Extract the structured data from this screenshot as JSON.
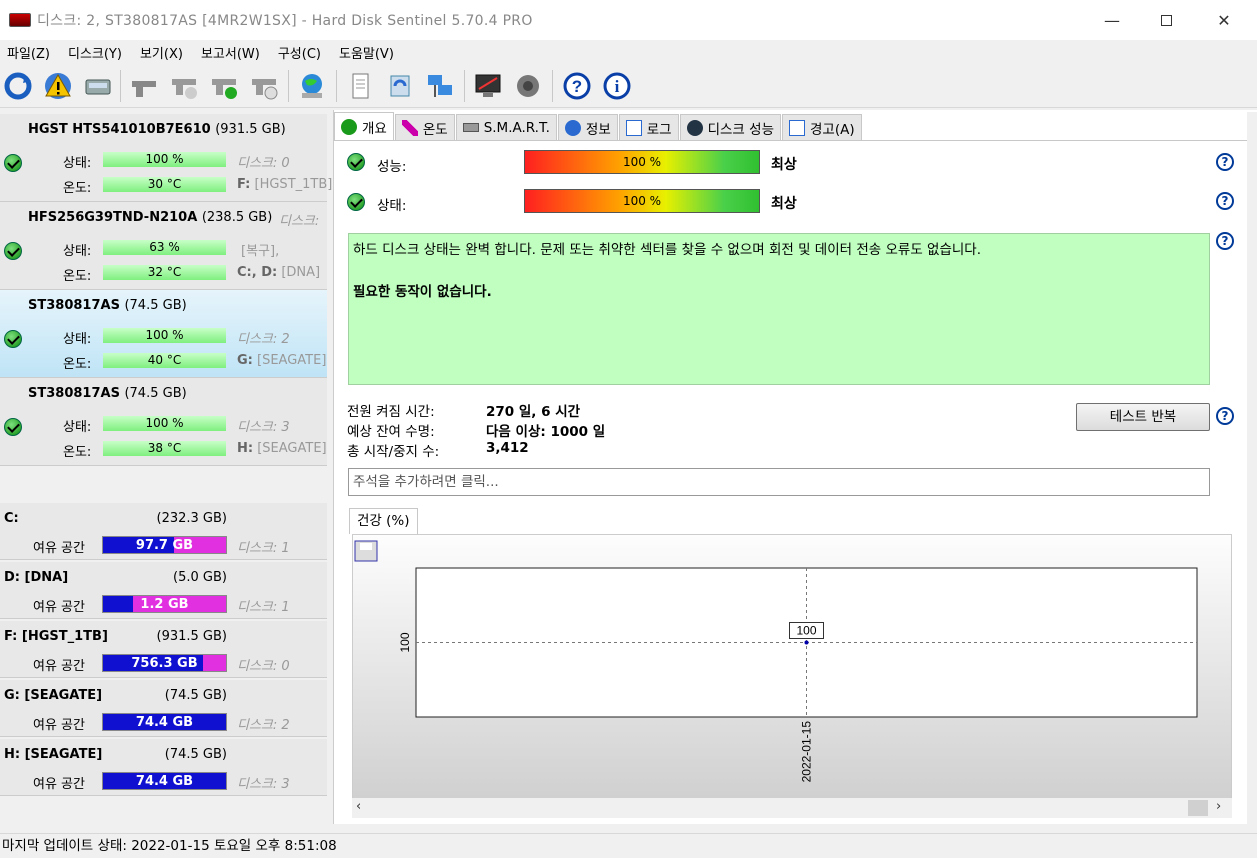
{
  "window": {
    "title": "디스크: 2, ST380817AS [4MR2W1SX]  -  Hard Disk Sentinel 5.70.4 PRO"
  },
  "menu": [
    "파일(Z)",
    "디스크(Y)",
    "보기(X)",
    "보고서(W)",
    "구성(C)",
    "도움말(V)"
  ],
  "disks": [
    {
      "name": "HGST HTS541010B7E610",
      "size": "(931.5 GB)",
      "health": "100 %",
      "temp": "30 °C",
      "health_note": "디스크: 0",
      "temp_note_drive": "F:",
      "temp_note": "[HGST_1TB]"
    },
    {
      "name": "HFS256G39TND-N210A",
      "size": "(238.5 GB)",
      "name_note": "디스크:",
      "health": "63 %",
      "temp": "32 °C",
      "health_note": "[복구],",
      "temp_note_drive": "C:, D:",
      "temp_note": "[DNA]"
    },
    {
      "name": "ST380817AS",
      "size": "(74.5 GB)",
      "health": "100 %",
      "temp": "40 °C",
      "health_note": "디스크: 2",
      "temp_note_drive": "G:",
      "temp_note": "[SEAGATE]"
    },
    {
      "name": "ST380817AS",
      "size": "(74.5 GB)",
      "health": "100 %",
      "temp": "38 °C",
      "health_note": "디스크: 3",
      "temp_note_drive": "H:",
      "temp_note": "[SEAGATE]"
    }
  ],
  "labels": {
    "health": "상태:",
    "temp": "온도:",
    "free": "여유 공간"
  },
  "partitions": [
    {
      "name": "C:",
      "size": "(232.3 GB)",
      "free": "97.7 GB",
      "free_ratio": 0.42,
      "disk": "디스크: 1"
    },
    {
      "name": "D: [DNA]",
      "size": "(5.0 GB)",
      "free": "1.2 GB",
      "free_ratio": 0.76,
      "disk": "디스크: 1"
    },
    {
      "name": "F: [HGST_1TB]",
      "size": "(931.5 GB)",
      "free": "756.3 GB",
      "free_ratio": 0.19,
      "disk": "디스크: 0"
    },
    {
      "name": "G: [SEAGATE]",
      "size": "(74.5 GB)",
      "free": "74.4 GB",
      "free_ratio": 0.0,
      "disk": "디스크: 2"
    },
    {
      "name": "H: [SEAGATE]",
      "size": "(74.5 GB)",
      "free": "74.4 GB",
      "free_ratio": 0.0,
      "disk": "디스크: 3"
    }
  ],
  "tabs": [
    "개요",
    "온도",
    "S.M.A.R.T.",
    "정보",
    "로그",
    "디스크 성능",
    "경고(A)"
  ],
  "overview": {
    "perf_label": "성능:",
    "perf_value": "100 %",
    "perf_rating": "최상",
    "health_label": "상태:",
    "health_value": "100 %",
    "health_rating": "최상",
    "status_text": "하드 디스크 상태는 완벽 합니다. 문제 또는 취약한 섹터를 찾을 수 없으며 회전 및 데이터 전송 오류도 없습니다.",
    "action_text": "필요한 동작이 없습니다.",
    "power_on_label": "전원 켜짐 시간:",
    "power_on_value": "270 일, 6 시간",
    "lifetime_label": "예상 잔여 수명:",
    "lifetime_value": "다음 이상: 1000 일",
    "startstop_label": "총 시작/중지 수:",
    "startstop_value": "3,412",
    "test_button": "테스트 반복",
    "note_placeholder": "주석을 추가하려면 클릭...",
    "chart_tab": "건강 (%)"
  },
  "chart_data": {
    "type": "line",
    "x": [
      "2022-01-15"
    ],
    "series": [
      {
        "values": [
          100
        ]
      }
    ],
    "ytick": "100",
    "point_label": "100"
  },
  "statusbar": "마지막 업데이트 상태: 2022-01-15 토요일 오후 8:51:08"
}
